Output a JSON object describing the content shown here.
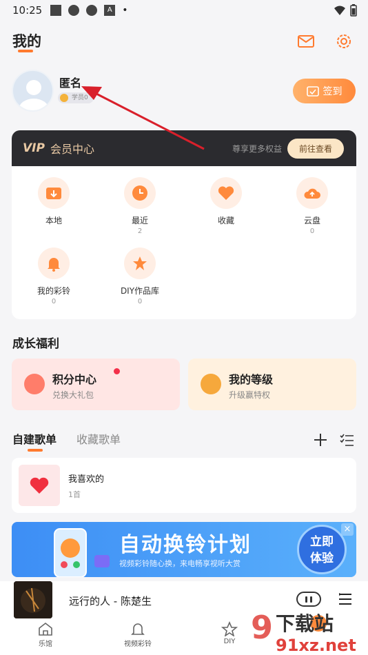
{
  "status_bar": {
    "time": "10:25",
    "icon_letter": "A"
  },
  "header": {
    "title": "我的"
  },
  "profile": {
    "name": "匿名",
    "level": "学员0",
    "signin_label": "签到"
  },
  "vip": {
    "logo": "VIP",
    "title": "会员中心",
    "subtitle": "尊享更多权益",
    "cta": "前往查看"
  },
  "quick_grid": [
    {
      "label": "本地",
      "count": ""
    },
    {
      "label": "最近",
      "count": "2"
    },
    {
      "label": "收藏",
      "count": ""
    },
    {
      "label": "云盘",
      "count": "0"
    },
    {
      "label": "我的彩铃",
      "count": "0"
    },
    {
      "label": "DIY作品库",
      "count": "0"
    }
  ],
  "growth": {
    "title": "成长福利",
    "points": {
      "title": "积分中心",
      "subtitle": "兑换大礼包"
    },
    "level": {
      "title": "我的等级",
      "subtitle": "升级赢特权"
    }
  },
  "playlist_tabs": [
    "自建歌单",
    "收藏歌单"
  ],
  "playlist": {
    "name": "我喜欢的",
    "count": "1首"
  },
  "banner": {
    "title": "自动换铃计划",
    "subtitle": "视频彩铃随心换，来电畅享视听大赏",
    "button_line1": "立即",
    "button_line2": "体验",
    "close": "×"
  },
  "player": {
    "song": "远行的人 - 陈楚生"
  },
  "bottom_nav": [
    "乐馆",
    "视频彩铃",
    "DIY"
  ],
  "watermark": {
    "big": "9 下载站",
    "small": "91xz.net"
  },
  "colors": {
    "accent": "#ff7a2e",
    "vip_bar": "#2b2b2f",
    "arrow": "#d9202b"
  }
}
